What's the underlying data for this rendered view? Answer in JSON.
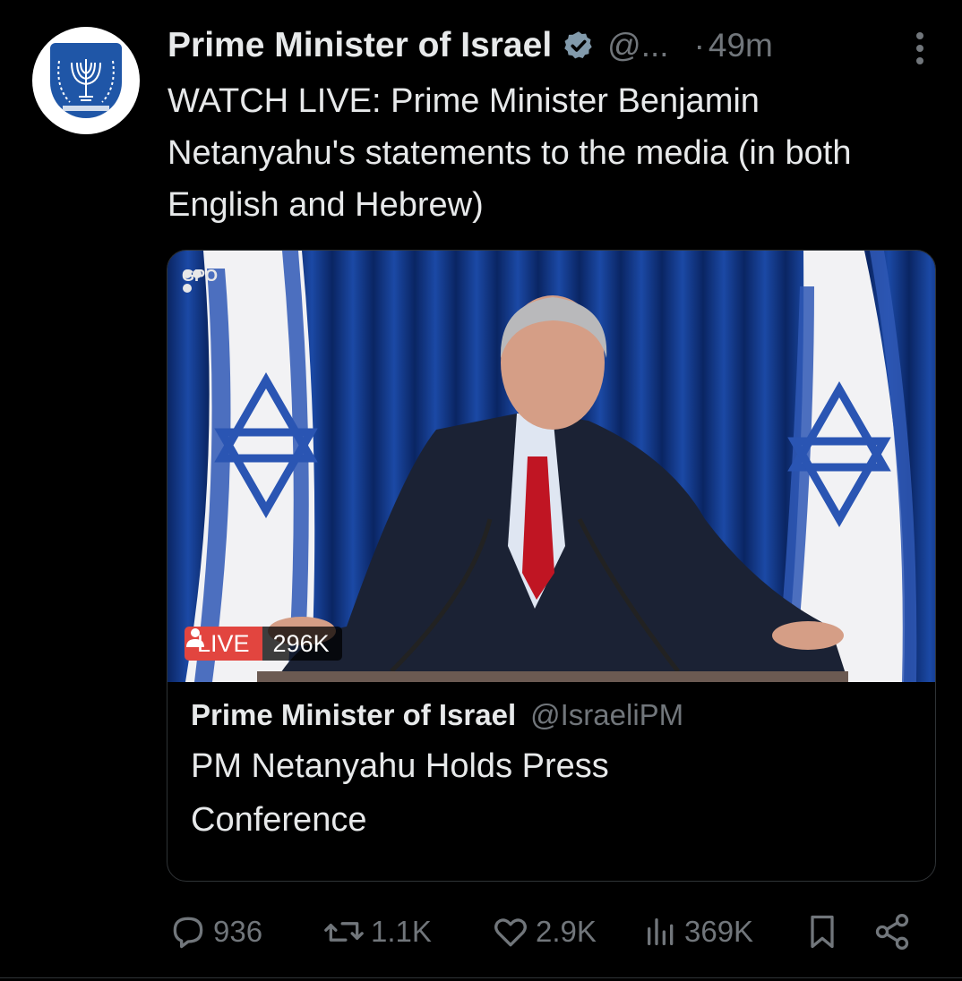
{
  "author": {
    "name": "Prime Minister of Israel",
    "handle": "@...",
    "separator": "·",
    "time": "49m"
  },
  "tweet": {
    "text": "WATCH LIVE: Prime Minister Benjamin Netanyahu's statements to the media (in both English and Hebrew)"
  },
  "card": {
    "watermark": "GPO",
    "live_label": "LIVE",
    "viewers": "296K",
    "author_name": "Prime Minister of Israel",
    "author_handle": "@IsraeliPM",
    "title": "PM Netanyahu Holds Press Conference"
  },
  "actions": {
    "replies": "936",
    "reposts": "1.1K",
    "likes": "2.9K",
    "views": "369K"
  },
  "colors": {
    "background": "#000000",
    "text": "#e7e9ea",
    "muted": "#71767b",
    "verified": "#829aab",
    "live": "#e2453f"
  }
}
